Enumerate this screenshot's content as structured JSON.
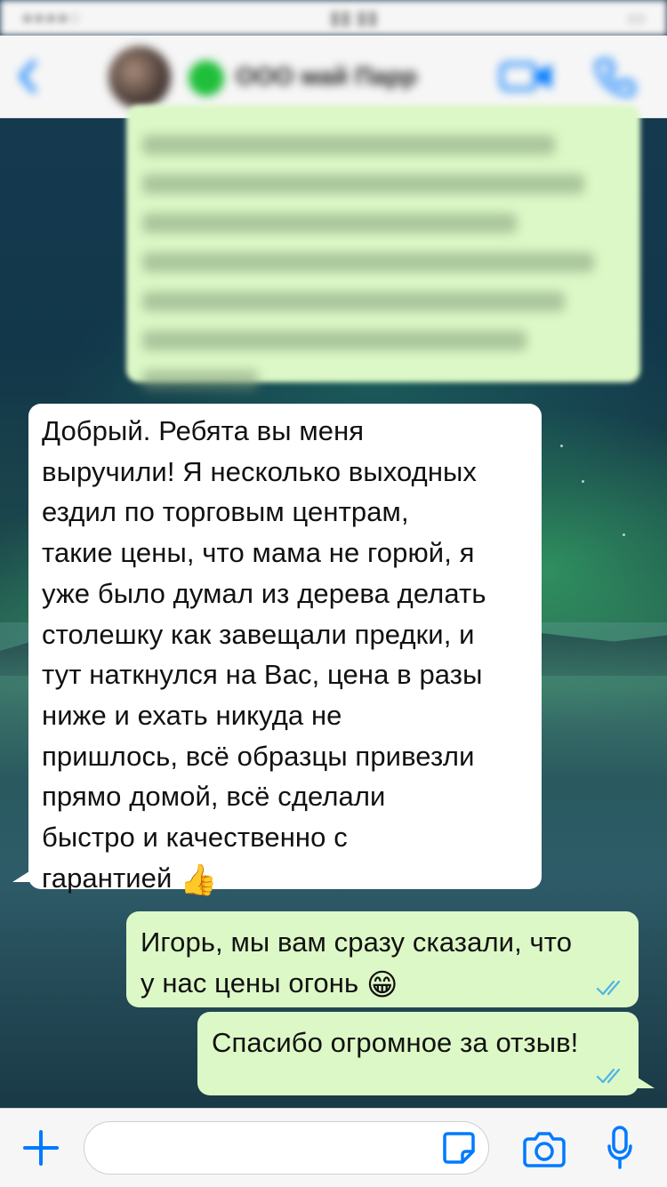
{
  "header": {
    "contact_name": "ООО май Парр"
  },
  "messages": {
    "incoming_1": {
      "lines": [
        "Добрый. Ребята вы меня",
        "выручили! Я несколько выходных",
        "ездил по торговым центрам,",
        "такие цены, что мама не горюй, я",
        "уже было думал из дерева делать",
        "столешку как завещали предки, и",
        "тут наткнулся на Вас, цена в разы",
        "ниже и ехать никуда не",
        "пришлось, всё образцы привезли",
        "прямо домой, всё сделали",
        "быстро и качественно с",
        "гарантией"
      ],
      "emoji": "👍"
    },
    "outgoing_1": {
      "lines": [
        "Игорь, мы вам сразу сказали, что",
        "у нас цены огонь"
      ],
      "emoji": "😁",
      "status": "read"
    },
    "outgoing_2": {
      "text": "Спасибо огромное за отзыв!",
      "status": "read"
    }
  },
  "input": {
    "placeholder": ""
  },
  "colors": {
    "accent": "#007aff",
    "outgoing_bubble": "#dcf8c6",
    "incoming_bubble": "#ffffff",
    "read_ticks": "#4fb4e6"
  }
}
